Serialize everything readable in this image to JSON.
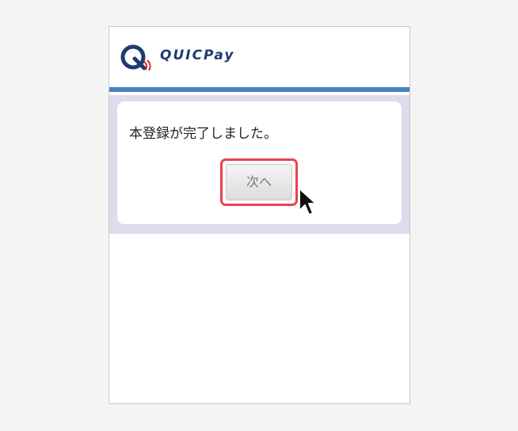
{
  "header": {
    "logo_text": "QUICPay",
    "logo_icon": "quicpay-logo-icon"
  },
  "dialog": {
    "message": "本登録が完了しました。",
    "next_button_label": "次へ"
  },
  "colors": {
    "brand_blue": "#1f3a73",
    "bar_blue": "#4a7fc0",
    "panel_bg": "#dcdcec",
    "highlight_red": "#e8434c",
    "logo_red": "#d42a2a"
  },
  "icons": {
    "cursor": "mouse-pointer-icon"
  }
}
